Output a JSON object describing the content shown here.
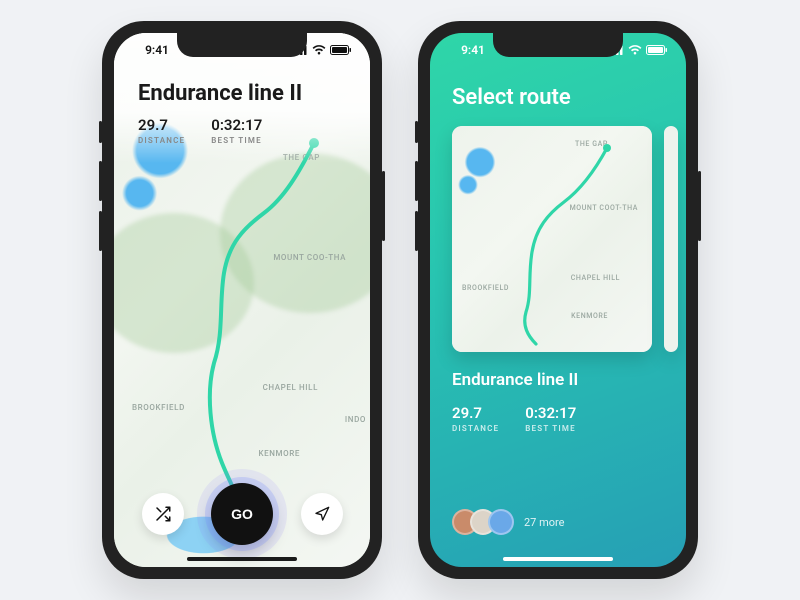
{
  "status": {
    "time": "9:41"
  },
  "phone1": {
    "route_title": "Endurance line II",
    "distance_value": "29.7",
    "distance_label": "DISTANCE",
    "best_time_value": "0:32:17",
    "best_time_label": "BEST TIME",
    "go_label": "GO",
    "map_labels": {
      "gap": "THE GAP",
      "mount": "MOUNT COO-THA",
      "brookfield": "BROOKFIELD",
      "chapel": "CHAPEL HILL",
      "kenmore": "KENMORE",
      "indoor": "INDO"
    }
  },
  "phone2": {
    "title": "Select route",
    "route_name": "Endurance line II",
    "distance_value": "29.7",
    "distance_label": "DISTANCE",
    "best_time_value": "0:32:17",
    "best_time_label": "BEST TIME",
    "more_text": "27 more",
    "card_labels": {
      "gap": "THE GAP",
      "mount": "MOUNT COOT-THA",
      "brookfield": "BROOKFIELD",
      "chapel": "CHAPEL HILL",
      "kenmore": "KENMORE"
    },
    "avatar_colors": [
      "#c98b6a",
      "#dcd4c8",
      "#6aa8e8"
    ]
  },
  "colors": {
    "route_stroke": "#2fd6a8",
    "home_dark": "#1a1a1a",
    "home_light": "#ffffff"
  }
}
